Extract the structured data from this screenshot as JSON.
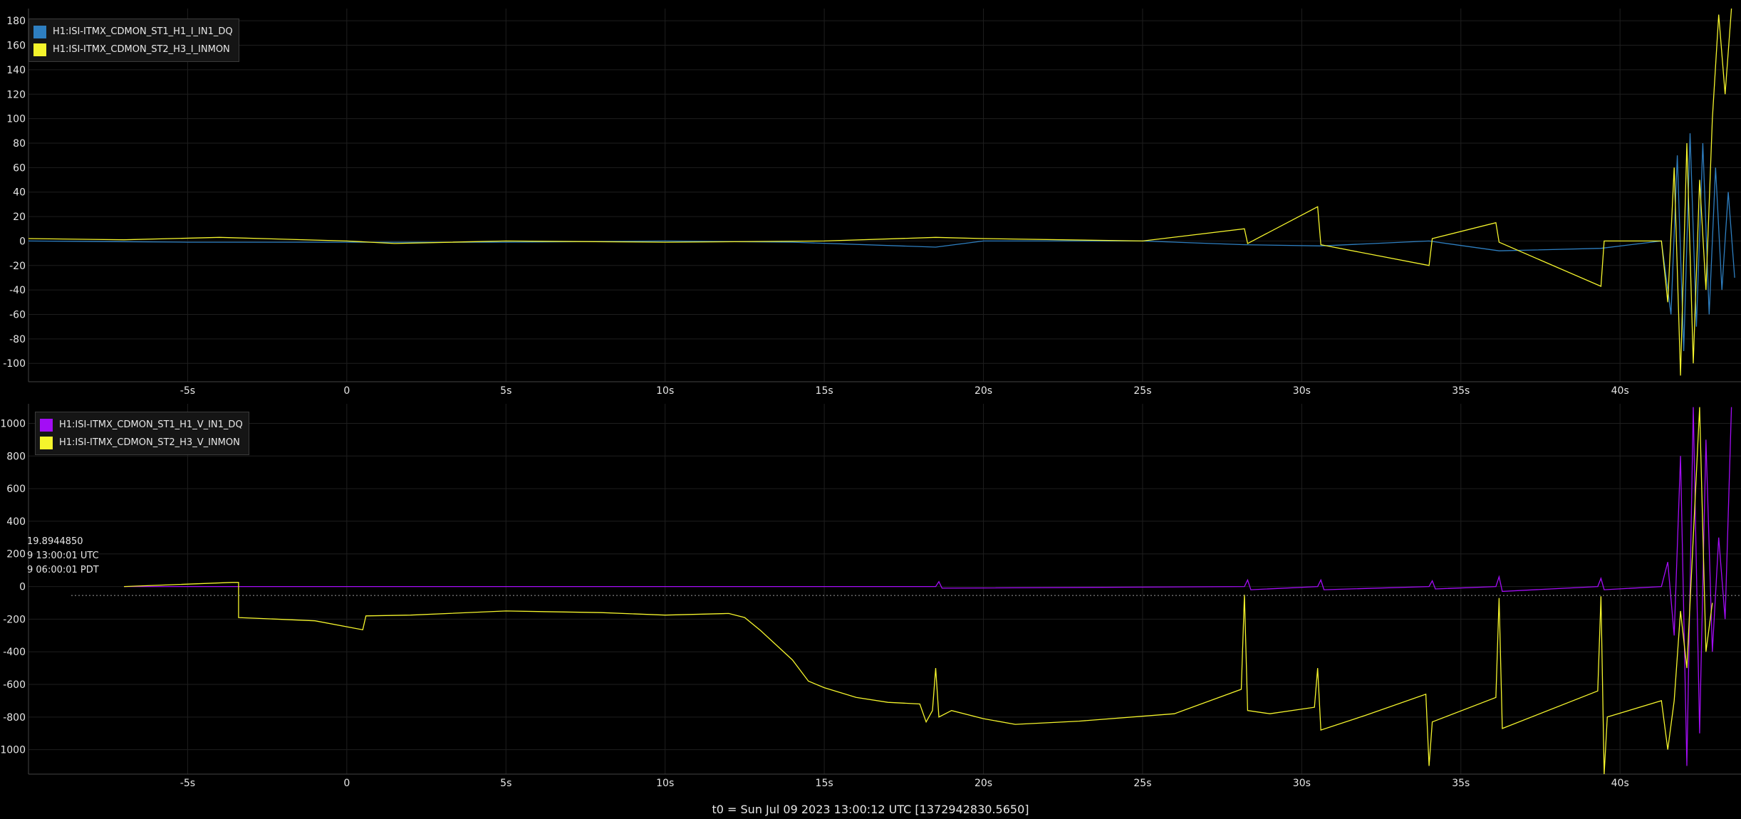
{
  "footer": {
    "t0_text": "t0 = Sun Jul 09 2023 13:00:12 UTC [1372942830.5650]"
  },
  "colors": {
    "blue": "#2e7fc1",
    "yellow": "#f5f52c",
    "purple": "#a30df5",
    "background": "#000000",
    "grid": "#1e1e1e"
  },
  "cursor_label": {
    "line1": "19.8944850",
    "line2": "9 13:00:01 UTC",
    "line3": "9 06:00:01 PDT"
  },
  "chart_data": [
    {
      "type": "line",
      "xlim": [
        -10,
        43.8
      ],
      "ylim": [
        -115,
        190
      ],
      "x_ticks": [
        -5,
        0,
        5,
        10,
        15,
        20,
        25,
        30,
        35,
        40
      ],
      "x_tick_labels": [
        "-5s",
        "0",
        "5s",
        "10s",
        "15s",
        "20s",
        "25s",
        "30s",
        "35s",
        "40s"
      ],
      "y_ticks": [
        180,
        160,
        140,
        120,
        100,
        80,
        60,
        40,
        20,
        0,
        -20,
        -40,
        -60,
        -80,
        -100
      ],
      "legend": "top-left",
      "series": [
        {
          "name": "H1:ISI-ITMX_CDMON_ST1_H1_I_IN1_DQ",
          "color": "#2e7fc1",
          "points": [
            [
              -10,
              0
            ],
            [
              -5,
              -1
            ],
            [
              0,
              -1
            ],
            [
              5,
              -1
            ],
            [
              10,
              0
            ],
            [
              14,
              -1
            ],
            [
              18.5,
              -5
            ],
            [
              20,
              0
            ],
            [
              25,
              0
            ],
            [
              28.2,
              -3
            ],
            [
              30.6,
              -4
            ],
            [
              34,
              0
            ],
            [
              36.2,
              -8
            ],
            [
              39.4,
              -6
            ],
            [
              41.3,
              0
            ],
            [
              41.6,
              -60
            ],
            [
              41.8,
              70
            ],
            [
              42.0,
              -90
            ],
            [
              42.2,
              88
            ],
            [
              42.4,
              -70
            ],
            [
              42.6,
              80
            ],
            [
              42.8,
              -60
            ],
            [
              43.0,
              60
            ],
            [
              43.2,
              -40
            ],
            [
              43.4,
              40
            ],
            [
              43.6,
              -30
            ]
          ]
        },
        {
          "name": "H1:ISI-ITMX_CDMON_ST2_H3_I_INMON",
          "color": "#f5f52c",
          "points": [
            [
              -10,
              2
            ],
            [
              -7,
              1
            ],
            [
              -4,
              3
            ],
            [
              0,
              0
            ],
            [
              1.5,
              -2
            ],
            [
              5,
              0
            ],
            [
              10,
              -1
            ],
            [
              15,
              0
            ],
            [
              18.5,
              3
            ],
            [
              20,
              2
            ],
            [
              25,
              0
            ],
            [
              28.2,
              10
            ],
            [
              28.3,
              -2
            ],
            [
              30.5,
              28
            ],
            [
              30.6,
              -3
            ],
            [
              34,
              -20
            ],
            [
              34.1,
              2
            ],
            [
              36.1,
              15
            ],
            [
              36.2,
              -1
            ],
            [
              39.4,
              -37
            ],
            [
              39.5,
              0
            ],
            [
              41.3,
              0
            ],
            [
              41.5,
              -50
            ],
            [
              41.7,
              60
            ],
            [
              41.9,
              -110
            ],
            [
              42.1,
              80
            ],
            [
              42.3,
              -100
            ],
            [
              42.5,
              50
            ],
            [
              42.7,
              -40
            ],
            [
              42.9,
              100
            ],
            [
              43.1,
              185
            ],
            [
              43.3,
              120
            ],
            [
              43.5,
              190
            ]
          ]
        }
      ]
    },
    {
      "type": "line",
      "xlim": [
        -10,
        43.8
      ],
      "ylim": [
        -1150,
        1120
      ],
      "x_ticks": [
        -5,
        0,
        5,
        10,
        15,
        20,
        25,
        30,
        35,
        40
      ],
      "x_tick_labels": [
        "-5s",
        "0",
        "5s",
        "10s",
        "15s",
        "20s",
        "25s",
        "30s",
        "35s",
        "40s"
      ],
      "y_ticks": [
        1000,
        800,
        600,
        400,
        200,
        0,
        -200,
        -400,
        -600,
        -800,
        -1000
      ],
      "legend": "top-left",
      "series": [
        {
          "name": "H1:ISI-ITMX_CDMON_ST1_H1_V_IN1_DQ",
          "color": "#a30df5",
          "points": [
            [
              -7,
              0
            ],
            [
              18.5,
              0
            ],
            [
              18.6,
              30
            ],
            [
              18.7,
              -10
            ],
            [
              28.2,
              0
            ],
            [
              28.3,
              40
            ],
            [
              28.4,
              -20
            ],
            [
              30.5,
              0
            ],
            [
              30.6,
              40
            ],
            [
              30.7,
              -20
            ],
            [
              34,
              0
            ],
            [
              34.1,
              35
            ],
            [
              34.2,
              -15
            ],
            [
              36.1,
              0
            ],
            [
              36.2,
              60
            ],
            [
              36.3,
              -30
            ],
            [
              39.3,
              0
            ],
            [
              39.4,
              50
            ],
            [
              39.5,
              -20
            ],
            [
              41.3,
              0
            ],
            [
              41.5,
              150
            ],
            [
              41.7,
              -300
            ],
            [
              41.9,
              800
            ],
            [
              42.1,
              -1100
            ],
            [
              42.3,
              1100
            ],
            [
              42.5,
              -900
            ],
            [
              42.7,
              900
            ],
            [
              42.9,
              -400
            ],
            [
              43.1,
              300
            ],
            [
              43.3,
              -200
            ],
            [
              43.5,
              1100
            ]
          ]
        },
        {
          "name": "H1:ISI-ITMX_CDMON_ST2_H3_V_INMON",
          "color": "#f5f52c",
          "points": [
            [
              -7,
              0
            ],
            [
              -3.6,
              25
            ],
            [
              -3.4,
              25
            ],
            [
              -3.4,
              -190
            ],
            [
              -1,
              -210
            ],
            [
              0.5,
              -265
            ],
            [
              0.6,
              -180
            ],
            [
              2,
              -175
            ],
            [
              5,
              -150
            ],
            [
              8,
              -160
            ],
            [
              10,
              -175
            ],
            [
              12,
              -165
            ],
            [
              12.5,
              -190
            ],
            [
              13,
              -270
            ],
            [
              14,
              -450
            ],
            [
              14.5,
              -580
            ],
            [
              15,
              -620
            ],
            [
              16,
              -680
            ],
            [
              17,
              -710
            ],
            [
              18,
              -720
            ],
            [
              18.2,
              -830
            ],
            [
              18.4,
              -760
            ],
            [
              18.5,
              -500
            ],
            [
              18.6,
              -800
            ],
            [
              19,
              -760
            ],
            [
              20,
              -810
            ],
            [
              21,
              -845
            ],
            [
              23,
              -825
            ],
            [
              26,
              -780
            ],
            [
              28.1,
              -630
            ],
            [
              28.2,
              -50
            ],
            [
              28.3,
              -760
            ],
            [
              29,
              -780
            ],
            [
              30.4,
              -740
            ],
            [
              30.5,
              -500
            ],
            [
              30.6,
              -880
            ],
            [
              32,
              -790
            ],
            [
              33.9,
              -660
            ],
            [
              34,
              -1100
            ],
            [
              34.1,
              -830
            ],
            [
              36.1,
              -680
            ],
            [
              36.2,
              -70
            ],
            [
              36.3,
              -870
            ],
            [
              39.3,
              -640
            ],
            [
              39.4,
              -60
            ],
            [
              39.5,
              -1150
            ],
            [
              39.6,
              -800
            ],
            [
              41.3,
              -700
            ],
            [
              41.5,
              -1000
            ],
            [
              41.7,
              -700
            ],
            [
              41.9,
              -150
            ],
            [
              42.1,
              -500
            ],
            [
              42.3,
              300
            ],
            [
              42.5,
              1100
            ],
            [
              42.7,
              -400
            ],
            [
              42.9,
              -100
            ]
          ]
        }
      ]
    }
  ],
  "legends": [
    {
      "items": [
        {
          "name": "H1:ISI-ITMX_CDMON_ST1_H1_I_IN1_DQ",
          "color": "#2e7fc1"
        },
        {
          "name": "H1:ISI-ITMX_CDMON_ST2_H3_I_INMON",
          "color": "#f5f52c"
        }
      ]
    },
    {
      "items": [
        {
          "name": "H1:ISI-ITMX_CDMON_ST1_H1_V_IN1_DQ",
          "color": "#a30df5"
        },
        {
          "name": "H1:ISI-ITMX_CDMON_ST2_H3_V_INMON",
          "color": "#f5f52c"
        }
      ]
    }
  ]
}
